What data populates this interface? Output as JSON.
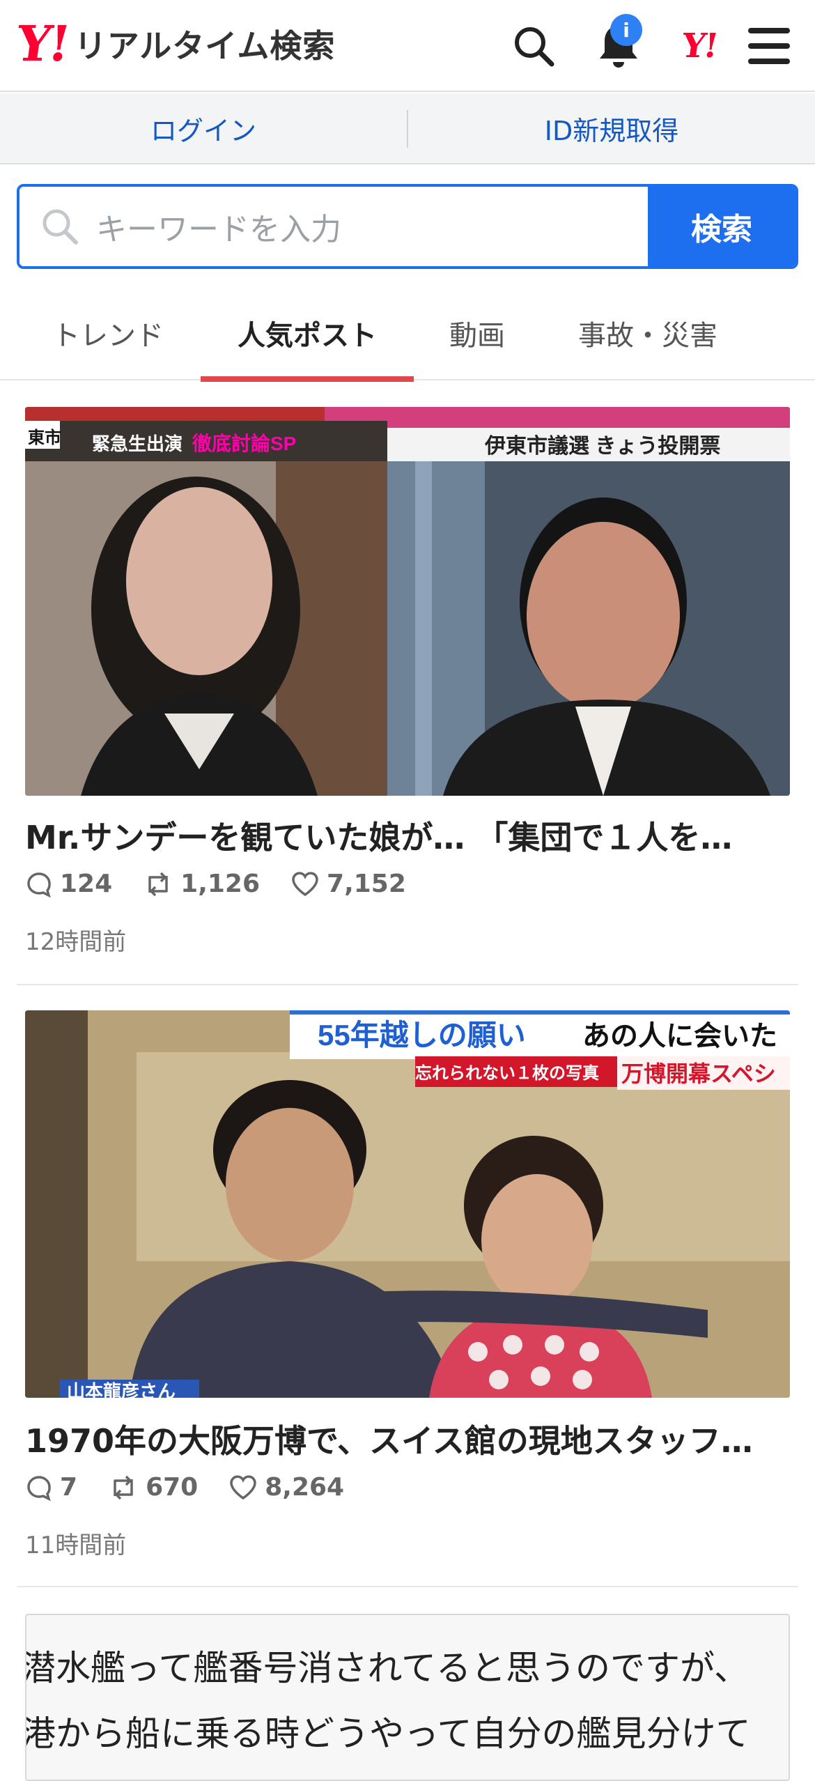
{
  "header": {
    "logo": "Y!",
    "title": "リアルタイム検索",
    "notification_badge": "i",
    "account_logo": "Y!",
    "icons": [
      "search-icon",
      "bell-icon",
      "yahoo-logo",
      "menu-icon"
    ]
  },
  "login_bar": {
    "login": "ログイン",
    "register": "ID新規取得"
  },
  "search": {
    "placeholder": "キーワードを入力",
    "button": "検索"
  },
  "tabs": [
    {
      "label": "トレンド",
      "active": false
    },
    {
      "label": "人気ポスト",
      "active": true
    },
    {
      "label": "動画",
      "active": false
    },
    {
      "label": "事故・災害",
      "active": false
    }
  ],
  "posts": [
    {
      "title": "Mr.サンデーを観ていた娘が… 「集団で１人を…",
      "replies": "124",
      "reposts": "1,126",
      "likes": "7,152",
      "time": "12時間前",
      "image_text": {
        "left_caption1": "緊急生出演",
        "left_caption2": "徹底討論SP",
        "left_corner": "東市",
        "right_caption": "伊東市議選 きょう投開票"
      }
    },
    {
      "title": "1970年の大阪万博で、スイス館の現地スタッフ…",
      "replies": "7",
      "reposts": "670",
      "likes": "8,264",
      "time": "11時間前",
      "image_text": {
        "caption1a": "55年越しの願い",
        "caption1b": "あの人に会いた",
        "caption2a": "忘れられない１枚の写真",
        "caption2b": "万博開幕スペシ",
        "name_tag": "山本龍彦さん"
      }
    },
    {
      "text_line1": "潜水艦って艦番号消されてると思うのですが、",
      "text_line2": "港から船に乗る時どうやって自分の艦見分けて"
    }
  ],
  "colors": {
    "brand_red": "#ff0033",
    "link_blue": "#1558c2",
    "search_blue": "#1e6ff0",
    "tab_indicator": "#e0474c"
  }
}
